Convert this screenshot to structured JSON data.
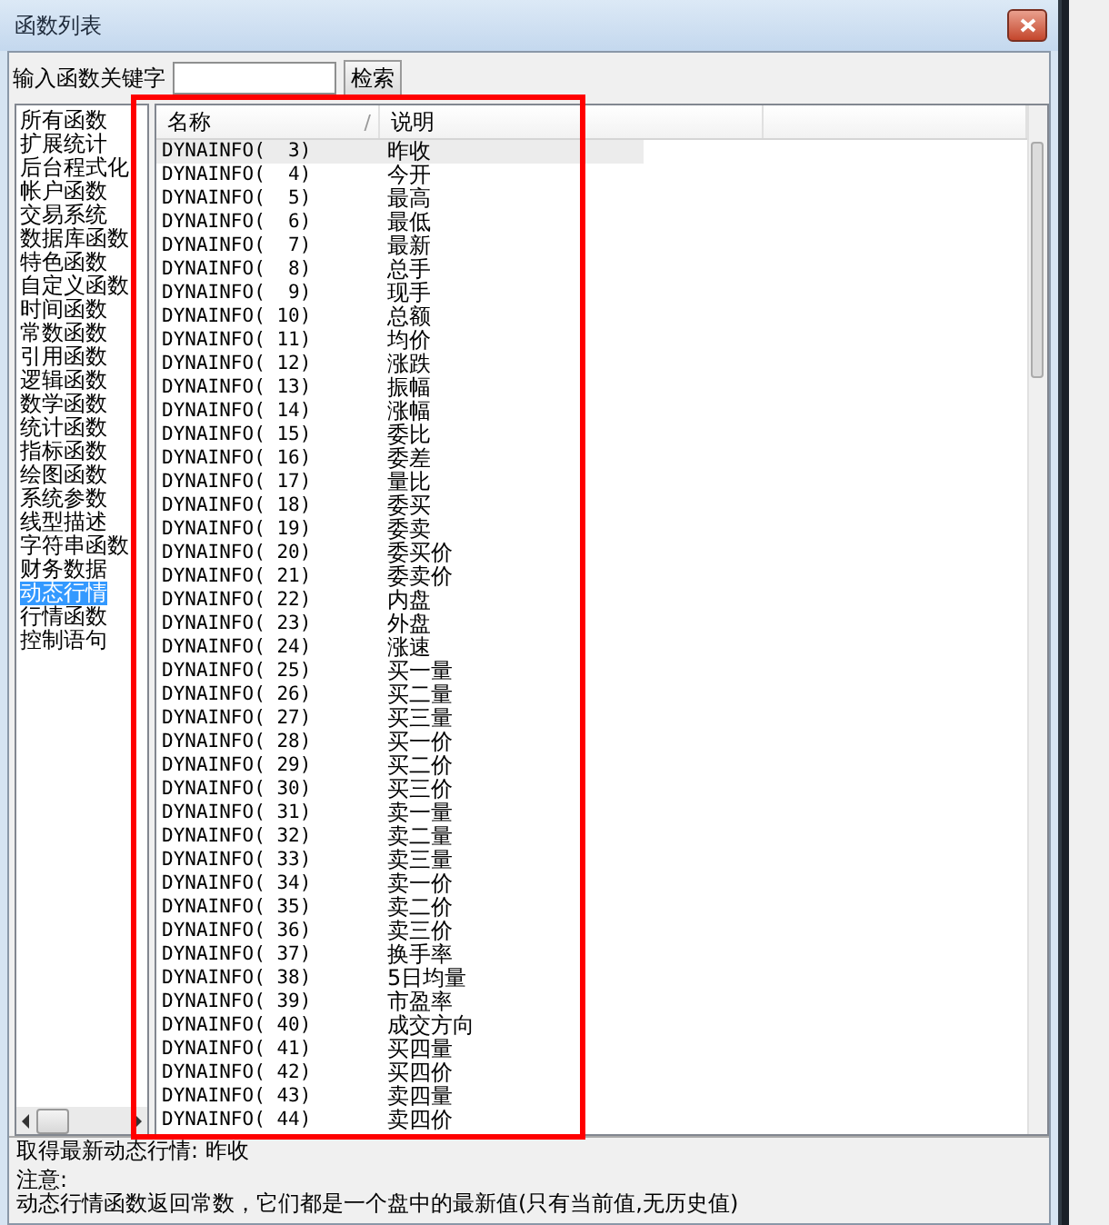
{
  "window": {
    "title": "函数列表"
  },
  "search": {
    "label": "输入函数关键字",
    "button": "检索"
  },
  "categories": [
    {
      "label": "所有函数",
      "selected": false
    },
    {
      "label": "扩展统计",
      "selected": false
    },
    {
      "label": "后台程式化",
      "selected": false
    },
    {
      "label": "帐户函数",
      "selected": false
    },
    {
      "label": "交易系统",
      "selected": false
    },
    {
      "label": "数据库函数",
      "selected": false
    },
    {
      "label": "特色函数",
      "selected": false
    },
    {
      "label": "自定义函数",
      "selected": false
    },
    {
      "label": "时间函数",
      "selected": false
    },
    {
      "label": "常数函数",
      "selected": false
    },
    {
      "label": "引用函数",
      "selected": false
    },
    {
      "label": "逻辑函数",
      "selected": false
    },
    {
      "label": "数学函数",
      "selected": false
    },
    {
      "label": "统计函数",
      "selected": false
    },
    {
      "label": "指标函数",
      "selected": false
    },
    {
      "label": "绘图函数",
      "selected": false
    },
    {
      "label": "系统参数",
      "selected": false
    },
    {
      "label": "线型描述",
      "selected": false
    },
    {
      "label": "字符串函数",
      "selected": false
    },
    {
      "label": "财务数据",
      "selected": false
    },
    {
      "label": "动态行情",
      "selected": true
    },
    {
      "label": "行情函数",
      "selected": false
    },
    {
      "label": "控制语句",
      "selected": false
    }
  ],
  "table": {
    "columns": [
      {
        "label": "名称",
        "sort": "/"
      },
      {
        "label": "说明"
      }
    ],
    "rows": [
      {
        "name": "DYNAINFO(  3)",
        "description": "昨收",
        "selected": true
      },
      {
        "name": "DYNAINFO(  4)",
        "description": "今开",
        "selected": false
      },
      {
        "name": "DYNAINFO(  5)",
        "description": "最高",
        "selected": false
      },
      {
        "name": "DYNAINFO(  6)",
        "description": "最低",
        "selected": false
      },
      {
        "name": "DYNAINFO(  7)",
        "description": "最新",
        "selected": false
      },
      {
        "name": "DYNAINFO(  8)",
        "description": "总手",
        "selected": false
      },
      {
        "name": "DYNAINFO(  9)",
        "description": "现手",
        "selected": false
      },
      {
        "name": "DYNAINFO( 10)",
        "description": "总额",
        "selected": false
      },
      {
        "name": "DYNAINFO( 11)",
        "description": "均价",
        "selected": false
      },
      {
        "name": "DYNAINFO( 12)",
        "description": "涨跌",
        "selected": false
      },
      {
        "name": "DYNAINFO( 13)",
        "description": "振幅",
        "selected": false
      },
      {
        "name": "DYNAINFO( 14)",
        "description": "涨幅",
        "selected": false
      },
      {
        "name": "DYNAINFO( 15)",
        "description": "委比",
        "selected": false
      },
      {
        "name": "DYNAINFO( 16)",
        "description": "委差",
        "selected": false
      },
      {
        "name": "DYNAINFO( 17)",
        "description": "量比",
        "selected": false
      },
      {
        "name": "DYNAINFO( 18)",
        "description": "委买",
        "selected": false
      },
      {
        "name": "DYNAINFO( 19)",
        "description": "委卖",
        "selected": false
      },
      {
        "name": "DYNAINFO( 20)",
        "description": "委买价",
        "selected": false
      },
      {
        "name": "DYNAINFO( 21)",
        "description": "委卖价",
        "selected": false
      },
      {
        "name": "DYNAINFO( 22)",
        "description": "内盘",
        "selected": false
      },
      {
        "name": "DYNAINFO( 23)",
        "description": "外盘",
        "selected": false
      },
      {
        "name": "DYNAINFO( 24)",
        "description": "涨速",
        "selected": false
      },
      {
        "name": "DYNAINFO( 25)",
        "description": "买一量",
        "selected": false
      },
      {
        "name": "DYNAINFO( 26)",
        "description": "买二量",
        "selected": false
      },
      {
        "name": "DYNAINFO( 27)",
        "description": "买三量",
        "selected": false
      },
      {
        "name": "DYNAINFO( 28)",
        "description": "买一价",
        "selected": false
      },
      {
        "name": "DYNAINFO( 29)",
        "description": "买二价",
        "selected": false
      },
      {
        "name": "DYNAINFO( 30)",
        "description": "买三价",
        "selected": false
      },
      {
        "name": "DYNAINFO( 31)",
        "description": "卖一量",
        "selected": false
      },
      {
        "name": "DYNAINFO( 32)",
        "description": "卖二量",
        "selected": false
      },
      {
        "name": "DYNAINFO( 33)",
        "description": "卖三量",
        "selected": false
      },
      {
        "name": "DYNAINFO( 34)",
        "description": "卖一价",
        "selected": false
      },
      {
        "name": "DYNAINFO( 35)",
        "description": "卖二价",
        "selected": false
      },
      {
        "name": "DYNAINFO( 36)",
        "description": "卖三价",
        "selected": false
      },
      {
        "name": "DYNAINFO( 37)",
        "description": "换手率",
        "selected": false
      },
      {
        "name": "DYNAINFO( 38)",
        "description": "5日均量",
        "selected": false
      },
      {
        "name": "DYNAINFO( 39)",
        "description": "市盈率",
        "selected": false
      },
      {
        "name": "DYNAINFO( 40)",
        "description": "成交方向",
        "selected": false
      },
      {
        "name": "DYNAINFO( 41)",
        "description": "买四量",
        "selected": false
      },
      {
        "name": "DYNAINFO( 42)",
        "description": "买四价",
        "selected": false
      },
      {
        "name": "DYNAINFO( 43)",
        "description": "卖四量",
        "selected": false
      },
      {
        "name": "DYNAINFO( 44)",
        "description": "卖四价",
        "selected": false
      }
    ]
  },
  "details": {
    "summary": "取得最新动态行情: 昨收",
    "note_label": "注意:",
    "note": "动态行情函数返回常数，它们都是一个盘中的最新值(只有当前值,无历史值)"
  }
}
